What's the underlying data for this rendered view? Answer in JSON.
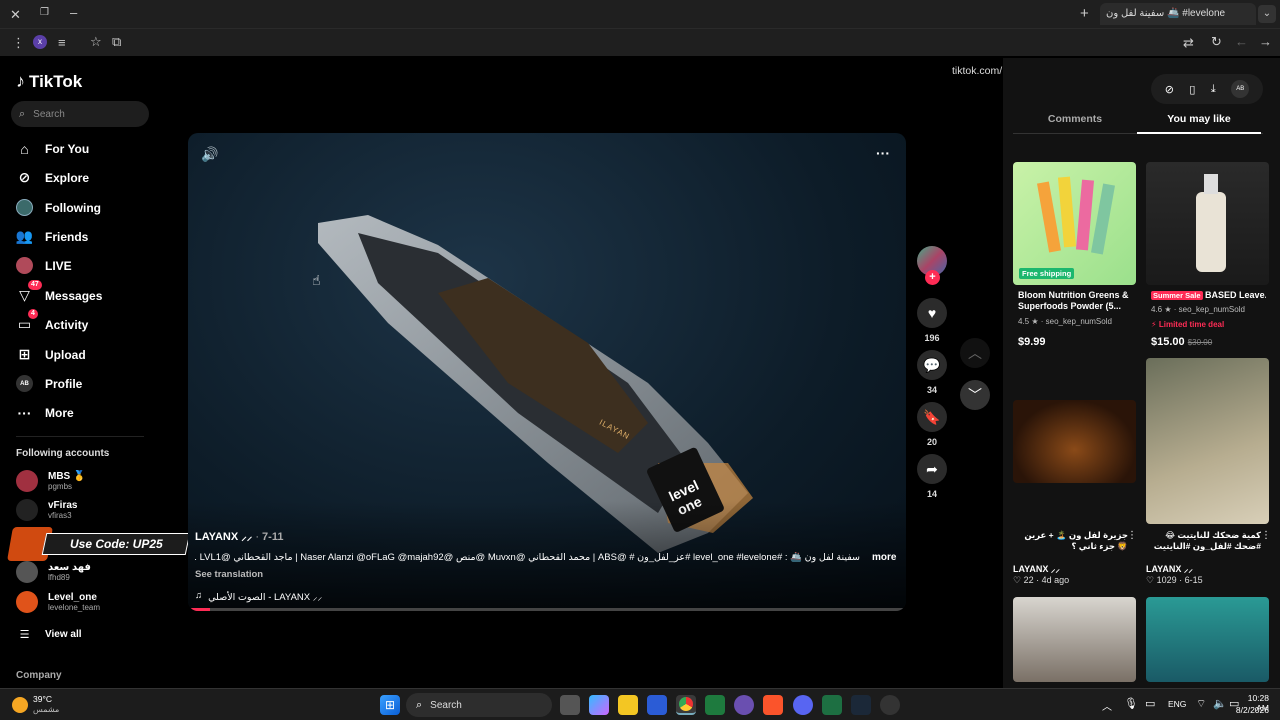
{
  "browser": {
    "tab_title": "سفينة لفل ون 🚢 #levelone",
    "url": "tiktok.com/@x_1layan0/video/7661231717818043666",
    "ext_badge": "x"
  },
  "sidebar": {
    "logo": "TikTok",
    "search_placeholder": "Search",
    "items": [
      {
        "label": "For You",
        "icon": "home-icon"
      },
      {
        "label": "Explore",
        "icon": "compass-icon"
      },
      {
        "label": "Following",
        "icon": "following-icon"
      },
      {
        "label": "Friends",
        "icon": "friends-icon"
      },
      {
        "label": "LIVE",
        "icon": "live-icon"
      },
      {
        "label": "Messages",
        "icon": "messages-icon",
        "badge": "47"
      },
      {
        "label": "Activity",
        "icon": "activity-icon",
        "badge": "4"
      },
      {
        "label": "Upload",
        "icon": "upload-icon"
      },
      {
        "label": "Profile",
        "icon": "profile-icon",
        "avatar_text": "AB"
      },
      {
        "label": "More",
        "icon": "more-icon"
      }
    ],
    "following_header": "Following accounts",
    "accounts": [
      {
        "name": "MBS 🥇",
        "handle": "pgmbs"
      },
      {
        "name": "vFiras",
        "handle": "vfiras3"
      },
      {
        "name": "",
        "handle": ""
      },
      {
        "name": "فهد سعد",
        "handle": "lfhd89"
      },
      {
        "name": "Level_one",
        "handle": "levelone_team"
      }
    ],
    "view_all": "View all",
    "company": "Company",
    "promo": "Use Code: UP25"
  },
  "video": {
    "author": "LAYANX ⸝⸝",
    "date": "7-11",
    "caption": "سفينة لفل ون 🚢 : #level_one #levelone #عز_لفل_ون # @ABS | محمد القحطاني @Muvxn @منص @Naser Alanzi @oFLaG @majah92 | ماجد القحطاني @LVL1 ...",
    "more": "more",
    "see_translation": "See translation",
    "sound": "الصوت الأصلي - LAYANX ⸝⸝",
    "boat_text": "ILAYAN",
    "progress": 0.03
  },
  "actions": {
    "likes": "196",
    "comments": "34",
    "saves": "20",
    "shares": "14"
  },
  "right_panel": {
    "tabs": [
      "Comments",
      "You may like"
    ],
    "active_tab": "You may like",
    "products": [
      {
        "badge": "Free shipping",
        "title": "Bloom Nutrition Greens & Superfoods Powder (5...",
        "rating": "4.5",
        "sold": "seo_kep_numSold",
        "price": "$9.99",
        "old_price": "",
        "tag": ""
      },
      {
        "badge": "",
        "tag": "Summer Sale",
        "title": "BASED Leave...",
        "rating": "4.6",
        "sold": "seo_kep_numSold",
        "deal": "Limited time deal",
        "price": "$15.00",
        "old_price": "$30.00"
      }
    ],
    "videos": [
      {
        "title": "جزيرة لفل ون 🏝️ + عرين 🦁 جزء ثاني ؟",
        "author": "LAYANX ⸝⸝",
        "likes": "22",
        "time": "4d ago"
      },
      {
        "title": "كمية ضحكك للنايتيت 😂 #ضحك #لفل_ون #النايتيت",
        "author": "LAYANX ⸝⸝",
        "likes": "1029",
        "time": "6-15"
      }
    ]
  },
  "taskbar": {
    "weather_temp": "39°C",
    "weather_desc": "مشمس",
    "search": "Search",
    "lang": "ENG",
    "time": "10:28 AM",
    "date": "8/2/2026"
  }
}
